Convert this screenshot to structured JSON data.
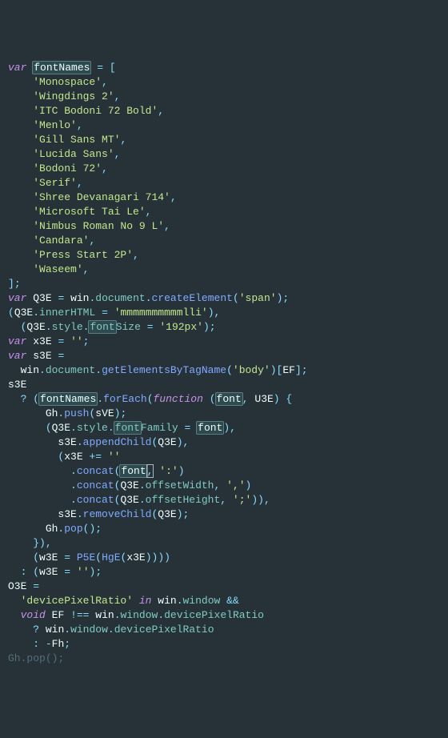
{
  "code": {
    "keyword_var": "var",
    "fontNames": "fontNames",
    "fonts": [
      "Monospace",
      "Wingdings 2",
      "ITC Bodoni 72 Bold",
      "Menlo",
      "Gill Sans MT",
      "Lucida Sans",
      "Bodoni 72",
      "Serif",
      "Shree Devanagari 714",
      "Microsoft Tai Le",
      "Nimbus Roman No 9 L",
      "Candara",
      "Press Start 2P",
      "Waseem"
    ],
    "Q3E": "Q3E",
    "win": "win",
    "document": "document",
    "createElement": "createElement",
    "span": "span",
    "innerHTML": "innerHTML",
    "mmmstr": "mmmmmmmmmmlli",
    "style": "style",
    "font": "font",
    "Size": "Size",
    "size192": "192px",
    "x3E": "x3E",
    "s3E": "s3E",
    "getElementsByTagName": "getElementsByTagName",
    "body": "body",
    "EF": "EF",
    "forEach": "forEach",
    "function": "function",
    "U3E": "U3E",
    "Gh": "Gh",
    "push": "push",
    "sVE": "sVE",
    "Family": "Family",
    "appendChild": "appendChild",
    "concat": "concat",
    "colon": ":",
    "offsetWidth": "offsetWidth",
    "comma": ",",
    "offsetHeight": "offsetHeight",
    "semicolon": ";",
    "removeChild": "removeChild",
    "pop": "pop",
    "w3E": "w3E",
    "P5E": "P5E",
    "HgE": "HgE",
    "empty": "",
    "O3E": "O3E",
    "devicePixelRatio": "devicePixelRatio",
    "in": "in",
    "window": "window",
    "and": "&&",
    "void": "void",
    "neq": "!==",
    "Fh": "Fh",
    "ghpop_partial": "Gh.pop();"
  }
}
